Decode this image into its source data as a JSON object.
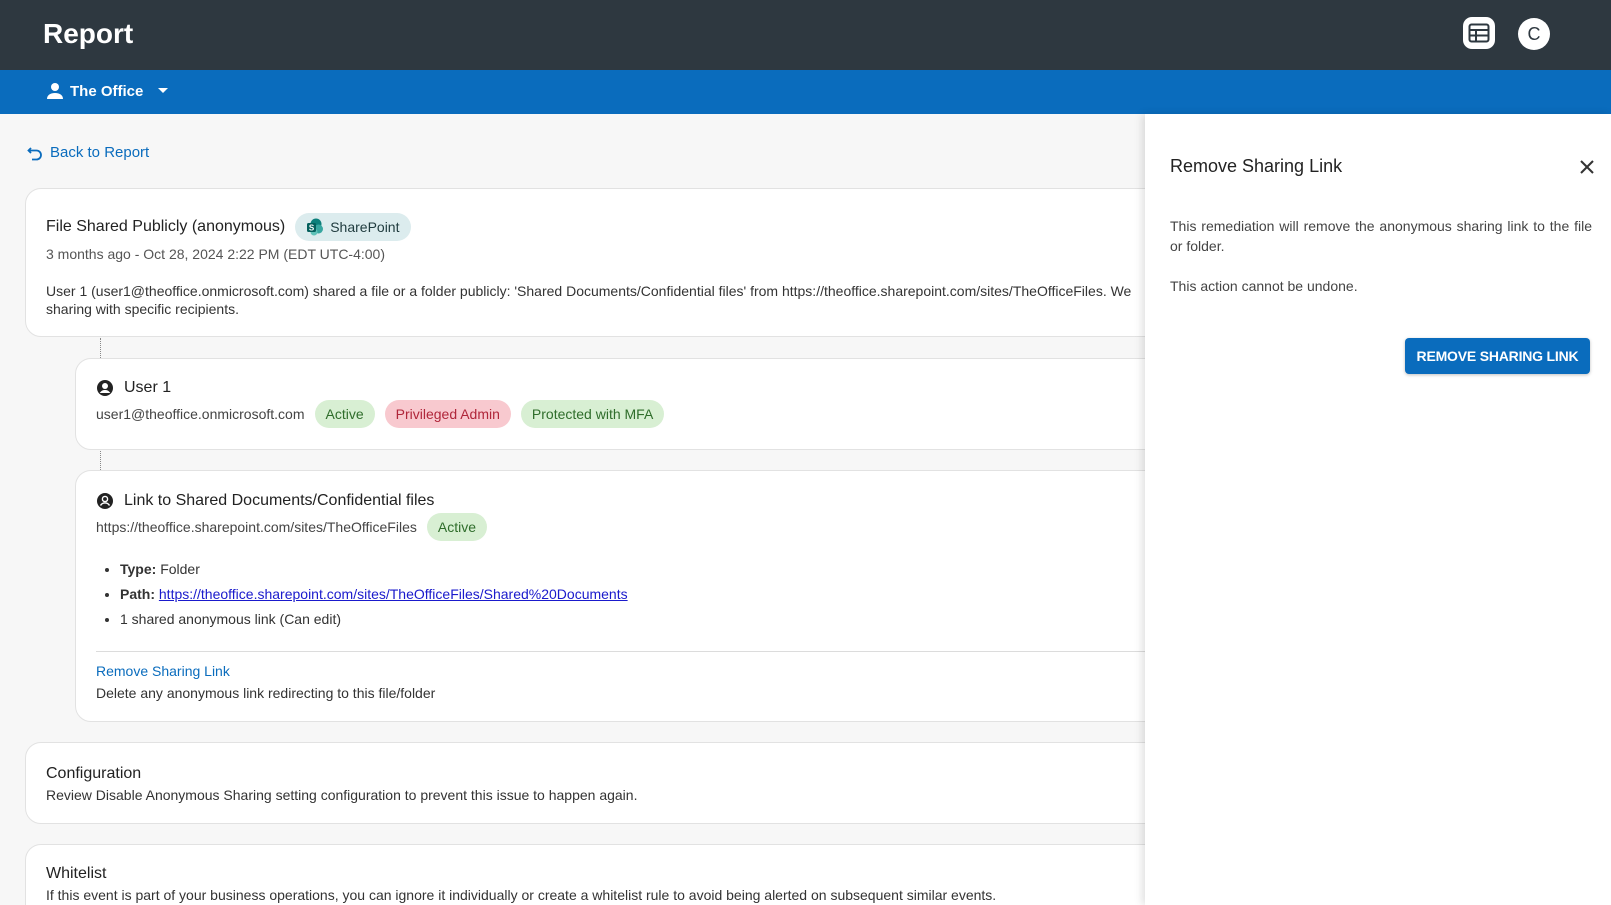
{
  "header": {
    "title": "Report",
    "avatar_letter": "C"
  },
  "subbar": {
    "tenant_label": "The Office"
  },
  "back": {
    "label": "Back to Report"
  },
  "event": {
    "title": "File Shared Publicly (anonymous)",
    "source_chip": "SharePoint",
    "timestamp": "3 months ago - Oct 28, 2024 2:22 PM (EDT UTC-4:00)",
    "description_line1": "User 1 (user1@theoffice.onmicrosoft.com) shared a file or a folder publicly: 'Shared Documents/Confidential files' from https://theoffice.sharepoint.com/sites/TheOfficeFiles. We",
    "description_line2": "sharing with specific recipients."
  },
  "user_card": {
    "name": "User 1",
    "email": "user1@theoffice.onmicrosoft.com",
    "chips": [
      "Active",
      "Privileged Admin",
      "Protected with MFA"
    ]
  },
  "link_card": {
    "title": "Link to Shared Documents/Confidential files",
    "site_url": "https://theoffice.sharepoint.com/sites/TheOfficeFiles",
    "status_chip": "Active",
    "type_label": "Type:",
    "type_value": " Folder",
    "path_label": "Path:",
    "path_value": "https://theoffice.sharepoint.com/sites/TheOfficeFiles/Shared%20Documents",
    "shared_links": "1 shared anonymous link (Can edit)",
    "action_link": "Remove Sharing Link",
    "action_desc": "Delete any anonymous link redirecting to this file/folder"
  },
  "configuration": {
    "title": "Configuration",
    "desc": "Review Disable Anonymous Sharing setting configuration to prevent this issue to happen again."
  },
  "whitelist": {
    "title": "Whitelist",
    "desc": "If this event is part of your business operations, you can ignore it individually or create a whitelist rule to avoid being alerted on subsequent similar events."
  },
  "panel": {
    "title": "Remove Sharing Link",
    "text1": "This remediation will remove the anonymous sharing link to the file or folder.",
    "text2": "This action cannot be undone.",
    "button": "REMOVE SHARING LINK"
  },
  "colors": {
    "topbar": "#2e3840",
    "subbar": "#0a6cbd",
    "chip_green": "#d8efd3",
    "chip_red": "#f8c9cf",
    "chip_sharepoint": "#dcecee"
  }
}
